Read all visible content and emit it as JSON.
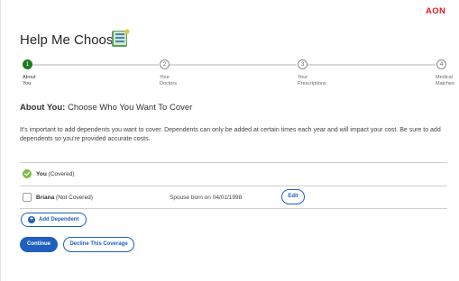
{
  "header": {
    "logo": "AON",
    "title": "Help Me Choose"
  },
  "stepper": {
    "steps": [
      {
        "number": "1",
        "label_line1": "About",
        "label_line2": "You",
        "active": true
      },
      {
        "number": "2",
        "label_line1": "Your",
        "label_line2": "Doctors",
        "active": false
      },
      {
        "number": "3",
        "label_line1": "Your",
        "label_line2": "Prescriptions",
        "active": false
      },
      {
        "number": "4",
        "label_line1": "Medical",
        "label_line2": "Matches",
        "active": false
      }
    ]
  },
  "section": {
    "heading_bold": "About You:",
    "heading_rest": "Choose Who You Want To Cover",
    "intro": "It's important to add dependents you want to cover. Dependents can only be added at certain times each year and will impact your cost. Be sure to add dependents so you're provided accurate costs."
  },
  "members": [
    {
      "name": "You",
      "status": "(Covered)",
      "checked": true
    },
    {
      "name": "Briana",
      "status": "(Not Covered)",
      "detail": "Spouse born on 04/01/1998",
      "edit_label": "Edit",
      "checked": false
    }
  ],
  "actions": {
    "add_dependent": "Add Dependent",
    "continue": "Continue",
    "decline": "Decline This Coverage"
  },
  "colors": {
    "accent": "#1f5fbf",
    "brand": "#e11b22",
    "success": "#1f7a1f",
    "check": "#7cbd42"
  }
}
